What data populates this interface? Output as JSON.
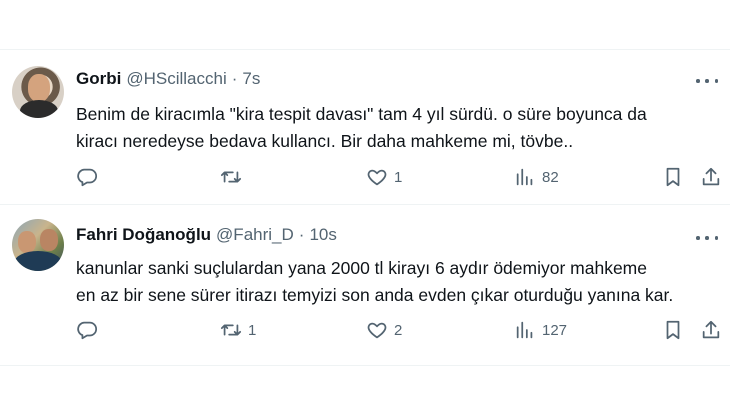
{
  "tweets": [
    {
      "name": "Gorbi",
      "handle": "@HScillacchi",
      "separator": "·",
      "time": "7s",
      "text_lines": [
        "Benim de kiracımla \"kira tespit davası\" tam 4 yıl sürdü. o süre boyunca da",
        "kiracı neredeyse bedava kullancı. Bir daha mahkeme mi, tövbe.."
      ],
      "counts": {
        "reply": "",
        "retweet": "",
        "like": "1",
        "views": "82"
      }
    },
    {
      "name": "Fahri Doğanoğlu",
      "handle": "@Fahri_D",
      "separator": "·",
      "time": "10s",
      "text_lines": [
        "kanunlar sanki suçlulardan yana 2000 tl kirayı 6 aydır ödemiyor mahkeme",
        "en az bir sene sürer itirazı temyizi son anda evden çıkar oturduğu yanına kar."
      ],
      "counts": {
        "reply": "",
        "retweet": "1",
        "like": "2",
        "views": "127"
      }
    }
  ],
  "icons": {
    "reply": "reply-icon",
    "retweet": "retweet-icon",
    "like": "heart-icon",
    "views": "views-icon",
    "bookmark": "bookmark-icon",
    "share": "share-icon",
    "more": "more-icon"
  },
  "colors": {
    "text": "#0f1419",
    "secondary": "#536471",
    "divider": "#eff3f4",
    "background": "#ffffff"
  }
}
